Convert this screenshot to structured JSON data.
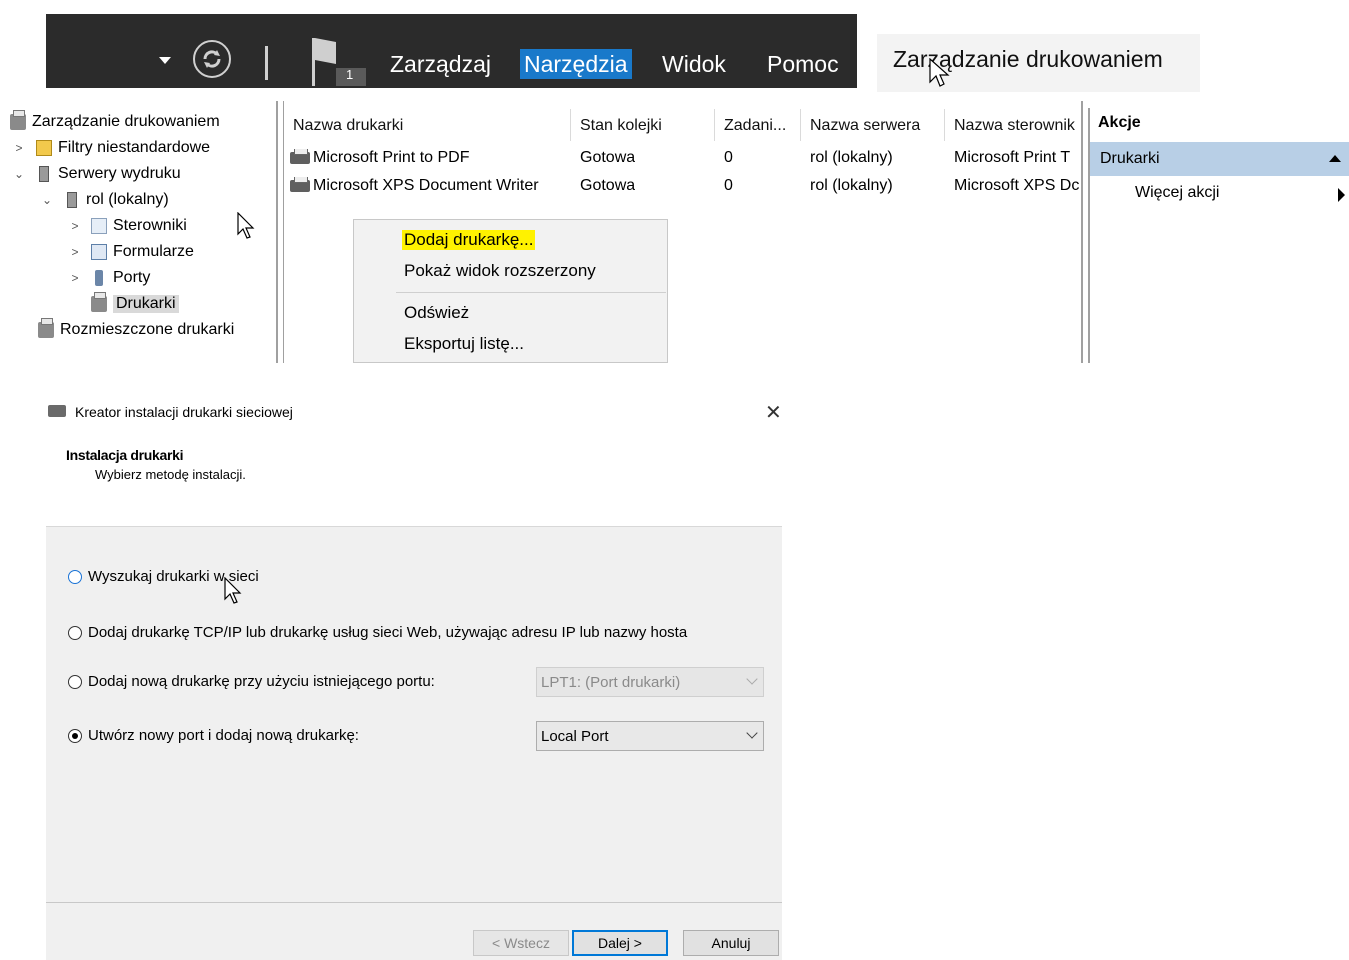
{
  "top_menu": {
    "flag_badge": "1",
    "items": [
      "Zarządzaj",
      "Narzędzia",
      "Widok",
      "Pomoc"
    ],
    "active_item": "Narzędzia",
    "accent": "#1979ca"
  },
  "title_box": {
    "title": "Zarządzanie drukowaniem"
  },
  "tree": {
    "items": [
      {
        "label": "Zarządzanie drukowaniem",
        "icon": "print-management-icon"
      },
      {
        "label": "Filtry niestandardowe",
        "icon": "filter-icon"
      },
      {
        "label": "Serwery wydruku",
        "icon": "server-icon"
      },
      {
        "label": "rol (lokalny)",
        "icon": "server-icon"
      },
      {
        "label": "Sterowniki",
        "icon": "drivers-icon"
      },
      {
        "label": "Formularze",
        "icon": "forms-icon"
      },
      {
        "label": "Porty",
        "icon": "port-icon"
      },
      {
        "label": "Drukarki",
        "icon": "printer-icon"
      },
      {
        "label": "Rozmieszczone drukarki",
        "icon": "printer-icon"
      }
    ],
    "selected": "Drukarki"
  },
  "printer_list": {
    "columns": [
      "Nazwa drukarki",
      "Stan kolejki",
      "Zadani...",
      "Nazwa serwera",
      "Nazwa sterownik"
    ],
    "rows": [
      [
        "Microsoft Print to PDF",
        "Gotowa",
        "0",
        "rol (lokalny)",
        "Microsoft Print T"
      ],
      [
        "Microsoft XPS Document Writer",
        "Gotowa",
        "0",
        "rol (lokalny)",
        "Microsoft XPS Dc"
      ]
    ]
  },
  "context_menu": {
    "items": [
      "Dodaj drukarkę...",
      "Pokaż widok rozszerzony",
      "Odśwież",
      "Eksportuj listę..."
    ],
    "highlight_color": "#fff200"
  },
  "actions": {
    "title": "Akcje",
    "group": "Drukarki",
    "more": "Więcej akcji",
    "group_color": "#b8cfe6"
  },
  "wizard": {
    "title": "Kreator instalacji drukarki sieciowej",
    "heading": "Instalacja drukarki",
    "subheading": "Wybierz metodę instalacji.",
    "options": [
      "Wyszukaj drukarki w sieci",
      "Dodaj drukarkę TCP/IP lub drukarkę usług sieci Web, używając adresu IP lub nazwy hosta",
      "Dodaj nową drukarkę przy użyciu istniejącego portu:",
      "Utwórz nowy port i dodaj nową drukarkę:"
    ],
    "selected_option": 3,
    "existing_port": "LPT1: (Port drukarki)",
    "new_port_type": "Local Port",
    "buttons": {
      "back": "< Wstecz",
      "next": "Dalej >",
      "cancel": "Anuluj"
    }
  }
}
